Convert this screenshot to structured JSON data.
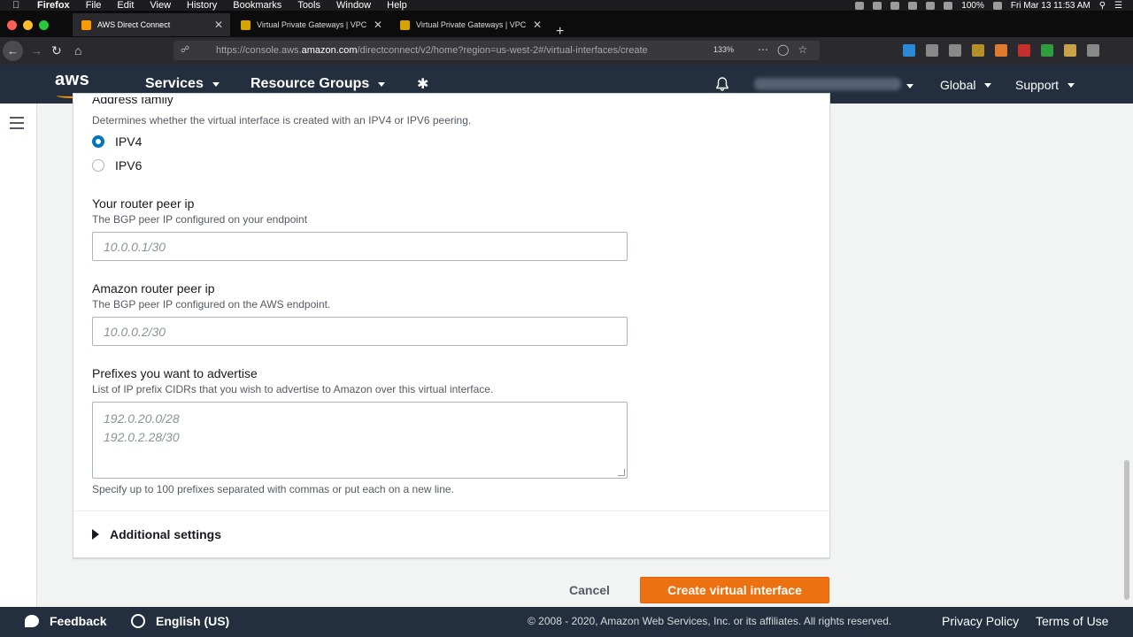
{
  "menubar": {
    "app": "Firefox",
    "items": [
      "File",
      "Edit",
      "View",
      "History",
      "Bookmarks",
      "Tools",
      "Window",
      "Help"
    ],
    "battery": "100%",
    "clock": "Fri Mar 13  11:53 AM"
  },
  "tabs": [
    {
      "title": "AWS Direct Connect",
      "active": true
    },
    {
      "title": "Virtual Private Gateways | VPC",
      "active": false
    },
    {
      "title": "Virtual Private Gateways | VPC",
      "active": false
    }
  ],
  "url": {
    "prefix": "https://console.aws.",
    "domain": "amazon.com",
    "path": "/directconnect/v2/home?region=us-west-2#/virtual-interfaces/create",
    "zoom": "133%"
  },
  "aws_header": {
    "logo": "aws",
    "services": "Services",
    "resource_groups": "Resource Groups",
    "region": "Global",
    "support": "Support"
  },
  "form": {
    "address_family": {
      "label": "Address family",
      "description": "Determines whether the virtual interface is created with an IPV4 or IPV6 peering.",
      "options": [
        "IPV4",
        "IPV6"
      ],
      "selected": "IPV4"
    },
    "router_peer_ip": {
      "label": "Your router peer ip",
      "description": "The BGP peer IP configured on your endpoint",
      "placeholder": "10.0.0.1/30"
    },
    "amazon_peer_ip": {
      "label": "Amazon router peer ip",
      "description": "The BGP peer IP configured on the AWS endpoint.",
      "placeholder": "10.0.0.2/30"
    },
    "prefixes": {
      "label": "Prefixes you want to advertise",
      "description": "List of IP prefix CIDRs that you wish to advertise to Amazon over this virtual interface.",
      "placeholder_line1": "192.0.20.0/28",
      "placeholder_line2": "192.0.2.28/30",
      "help": "Specify up to 100 prefixes separated with commas or put each on a new line."
    },
    "additional_settings": "Additional settings"
  },
  "actions": {
    "cancel": "Cancel",
    "create": "Create virtual interface"
  },
  "footer": {
    "feedback": "Feedback",
    "language": "English (US)",
    "copyright": "© 2008 - 2020, Amazon Web Services, Inc. or its affiliates. All rights reserved.",
    "privacy": "Privacy Policy",
    "terms": "Terms of Use"
  },
  "colors": {
    "aws_header": "#232f3e",
    "primary_button": "#ec7211",
    "radio_selected": "#0073bb"
  }
}
